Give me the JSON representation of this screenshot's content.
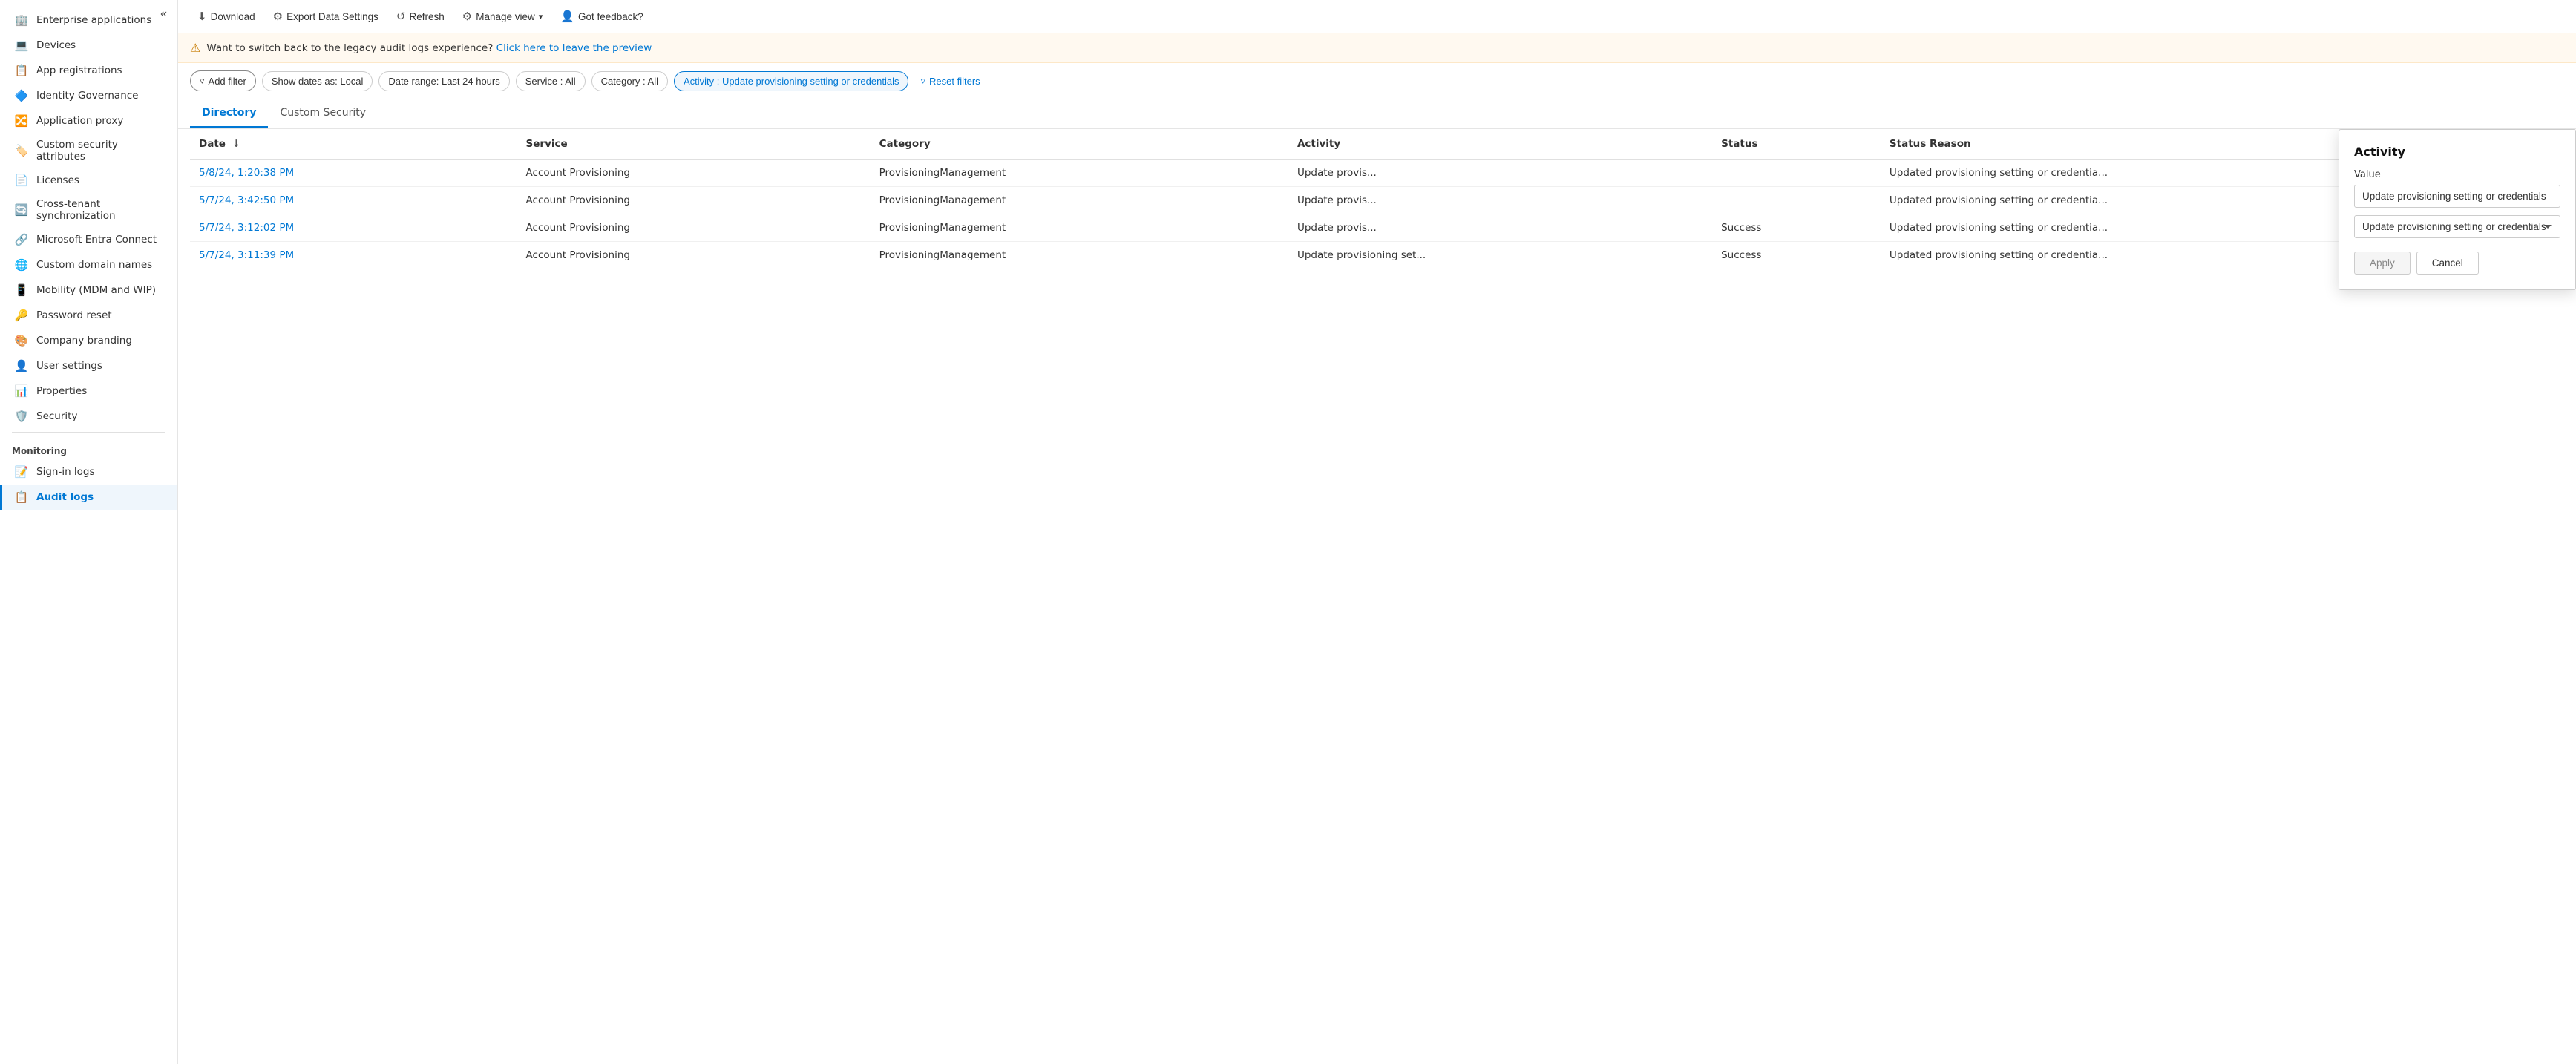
{
  "sidebar": {
    "collapse_label": "«",
    "items": [
      {
        "id": "enterprise-applications",
        "label": "Enterprise applications",
        "icon": "🏢",
        "active": false
      },
      {
        "id": "devices",
        "label": "Devices",
        "icon": "💻",
        "active": false
      },
      {
        "id": "app-registrations",
        "label": "App registrations",
        "icon": "📋",
        "active": false
      },
      {
        "id": "identity-governance",
        "label": "Identity Governance",
        "icon": "🔷",
        "active": false
      },
      {
        "id": "application-proxy",
        "label": "Application proxy",
        "icon": "🔀",
        "active": false
      },
      {
        "id": "custom-security-attributes",
        "label": "Custom security attributes",
        "icon": "🏷️",
        "active": false
      },
      {
        "id": "licenses",
        "label": "Licenses",
        "icon": "📄",
        "active": false
      },
      {
        "id": "cross-tenant-synchronization",
        "label": "Cross-tenant synchronization",
        "icon": "🔄",
        "active": false
      },
      {
        "id": "microsoft-entra-connect",
        "label": "Microsoft Entra Connect",
        "icon": "🔗",
        "active": false
      },
      {
        "id": "custom-domain-names",
        "label": "Custom domain names",
        "icon": "🌐",
        "active": false
      },
      {
        "id": "mobility-mdm-wip",
        "label": "Mobility (MDM and WIP)",
        "icon": "📱",
        "active": false
      },
      {
        "id": "password-reset",
        "label": "Password reset",
        "icon": "🔑",
        "active": false
      },
      {
        "id": "company-branding",
        "label": "Company branding",
        "icon": "🎨",
        "active": false
      },
      {
        "id": "user-settings",
        "label": "User settings",
        "icon": "👤",
        "active": false
      },
      {
        "id": "properties",
        "label": "Properties",
        "icon": "📊",
        "active": false
      },
      {
        "id": "security",
        "label": "Security",
        "icon": "🛡️",
        "active": false
      }
    ],
    "monitoring_section": "Monitoring",
    "monitoring_items": [
      {
        "id": "sign-in-logs",
        "label": "Sign-in logs",
        "icon": "📝",
        "active": false
      },
      {
        "id": "audit-logs",
        "label": "Audit logs",
        "icon": "📋",
        "active": true
      }
    ]
  },
  "toolbar": {
    "download_label": "Download",
    "export_label": "Export Data Settings",
    "refresh_label": "Refresh",
    "manage_view_label": "Manage view",
    "feedback_label": "Got feedback?"
  },
  "banner": {
    "text": "Want to switch back to the legacy audit logs experience? Click here to leave the preview.",
    "link_text": "Click here to leave the preview"
  },
  "filters": {
    "add_filter_label": "Add filter",
    "show_dates_label": "Show dates as: Local",
    "date_range_label": "Date range: Last 24 hours",
    "service_label": "Service : All",
    "category_label": "Category : All",
    "activity_label": "Activity : Update provisioning setting or credentials",
    "reset_label": "Reset filters"
  },
  "tabs": [
    {
      "id": "directory",
      "label": "Directory",
      "active": true
    },
    {
      "id": "custom-security",
      "label": "Custom Security",
      "active": false
    }
  ],
  "table": {
    "columns": [
      {
        "id": "date",
        "label": "Date",
        "sort": "↓"
      },
      {
        "id": "service",
        "label": "Service"
      },
      {
        "id": "category",
        "label": "Category"
      },
      {
        "id": "activity",
        "label": "Activity"
      },
      {
        "id": "status",
        "label": "Status"
      },
      {
        "id": "status-reason",
        "label": "Status Reason"
      }
    ],
    "rows": [
      {
        "date": "5/8/24, 1:20:38 PM",
        "service": "Account Provisioning",
        "category": "ProvisioningManagement",
        "activity": "Update provis...",
        "status": "",
        "status_reason": "Updated provisioning setting or credentia..."
      },
      {
        "date": "5/7/24, 3:42:50 PM",
        "service": "Account Provisioning",
        "category": "ProvisioningManagement",
        "activity": "Update provis...",
        "status": "",
        "status_reason": "Updated provisioning setting or credentia..."
      },
      {
        "date": "5/7/24, 3:12:02 PM",
        "service": "Account Provisioning",
        "category": "ProvisioningManagement",
        "activity": "Update provis...",
        "status": "Success",
        "status_reason": "Updated provisioning setting or credentia..."
      },
      {
        "date": "5/7/24, 3:11:39 PM",
        "service": "Account Provisioning",
        "category": "ProvisioningManagement",
        "activity": "Update provisioning set...",
        "status": "Success",
        "status_reason": "Updated provisioning setting or credentia..."
      }
    ]
  },
  "activity_popup": {
    "title": "Activity",
    "value_label": "Value",
    "input_value": "Update provisioning setting or credentials",
    "select_value": "Update provisioning setting or credentials",
    "apply_label": "Apply",
    "cancel_label": "Cancel",
    "select_options": [
      "Update provisioning setting or credentials"
    ]
  }
}
